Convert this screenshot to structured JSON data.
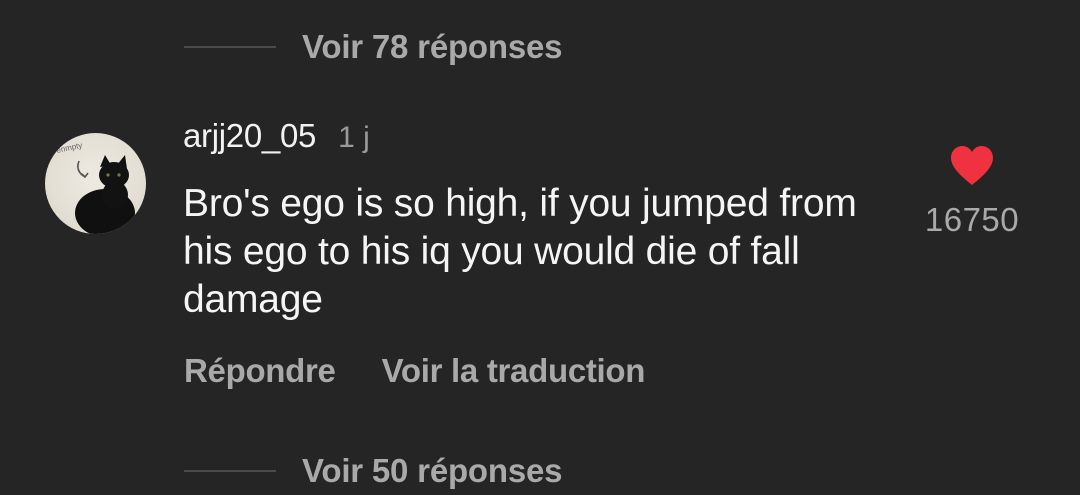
{
  "replies_top": {
    "label": "Voir 78 réponses"
  },
  "comment": {
    "username": "arjj20_05",
    "time": "1 j",
    "text": "Bro's ego is so high, if you jumped from his ego to his iq you would die of fall damage",
    "avatar_caption": "enmpty",
    "like_count": "16750",
    "liked": true,
    "heart_color": "#f0313f",
    "actions": {
      "reply": "Répondre",
      "translate": "Voir la traduction"
    }
  },
  "replies_bottom": {
    "label": "Voir 50 réponses"
  },
  "colors": {
    "background": "#252526",
    "primary_text": "#f5f5f5",
    "secondary_text": "#a9a9a9"
  }
}
